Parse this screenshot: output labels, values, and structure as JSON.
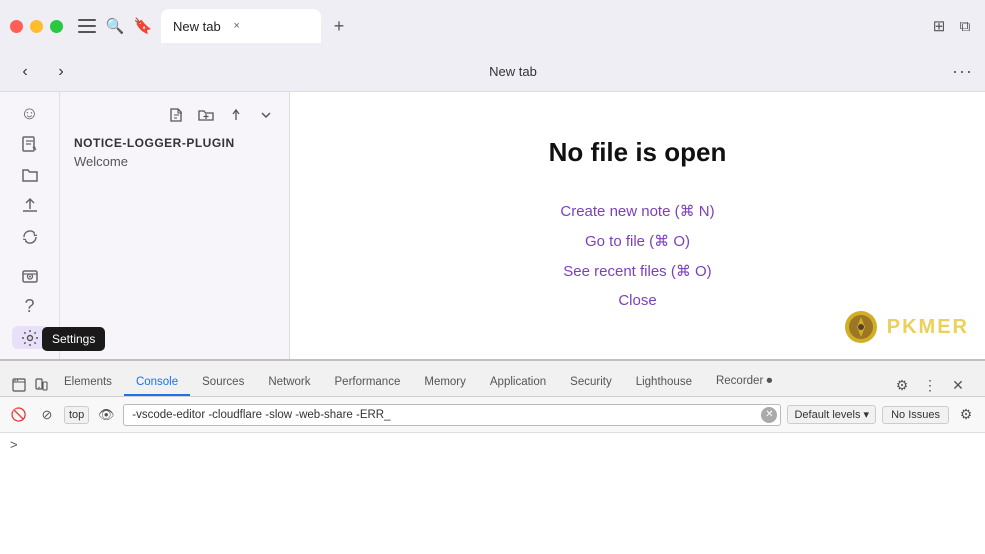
{
  "browser": {
    "tab_label": "New tab",
    "tab_close": "×",
    "tab_add": "+",
    "nav_back": "‹",
    "nav_forward": "›",
    "address_title": "New tab",
    "nav_more": "···"
  },
  "sidebar": {
    "icons": [
      "☺",
      "⎘",
      "◱",
      "↑",
      "⌥"
    ],
    "bottom_icons": [
      "⬚",
      "?",
      "⚙"
    ],
    "settings_tooltip": "Settings"
  },
  "file_panel": {
    "toolbar_icons": [
      "✎",
      "⊕",
      "↑",
      "⇅"
    ],
    "plugin_name": "NOTICE-LOGGER-PLUGIN",
    "welcome_label": "Welcome"
  },
  "editor": {
    "no_file_title": "No file is open",
    "actions": [
      "Create new note (⌘ N)",
      "Go to file (⌘ O)",
      "See recent files (⌘ O)",
      "Close"
    ]
  },
  "devtools": {
    "tabs": [
      "Elements",
      "Console",
      "Sources",
      "Network",
      "Performance",
      "Memory",
      "Application",
      "Security",
      "Lighthouse",
      "Recorder ⏺"
    ],
    "active_tab": "Console",
    "toolbar": {
      "top_label": "top",
      "filter_value": "-vscode-editor -cloudflare -slow -web-share -ERR_",
      "levels_label": "Default levels ▾",
      "issues_label": "No Issues"
    },
    "console_prompt_arrow": ">"
  },
  "pkmer": {
    "text": "PKMER"
  },
  "colors": {
    "accent_purple": "#7b3fbe",
    "active_tab_blue": "#1a73e8",
    "bg_purple": "#3a0060"
  }
}
